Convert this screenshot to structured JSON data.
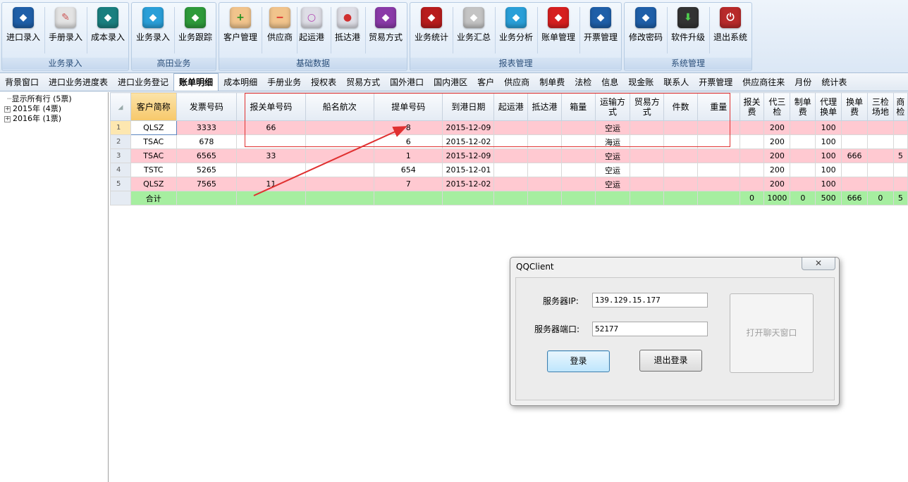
{
  "ribbon": {
    "groups": [
      {
        "label": "业务录入",
        "buttons": [
          {
            "label": "进口录入",
            "icon": "import-entry-icon",
            "color": "#1f5fa8",
            "glyph": "◆"
          },
          {
            "label": "手册录入",
            "icon": "manual-entry-icon",
            "color": "#d8d8d8",
            "glyph": "✎"
          },
          {
            "label": "成本录入",
            "icon": "cost-entry-icon",
            "color": "#1a8a8a",
            "glyph": "◆"
          }
        ]
      },
      {
        "label": "高田业务",
        "buttons": [
          {
            "label": "业务录入",
            "icon": "business-entry-icon",
            "color": "#2a9fd8",
            "glyph": "◆"
          },
          {
            "label": "业务跟踪",
            "icon": "business-track-icon",
            "color": "#2e9a3a",
            "glyph": "◆"
          }
        ]
      },
      {
        "label": "基础数据",
        "buttons": [
          {
            "label": "客户管理",
            "icon": "customer-add-icon",
            "color": "#e8b070",
            "glyph": "+"
          },
          {
            "label": "供应商",
            "icon": "supplier-icon",
            "color": "#e8b070",
            "glyph": "−"
          },
          {
            "label": "起运港",
            "icon": "origin-port-icon",
            "color": "#d0d0d8",
            "glyph": "○"
          },
          {
            "label": "抵达港",
            "icon": "arrival-port-icon",
            "color": "#d0d0d8",
            "glyph": "●"
          },
          {
            "label": "贸易方式",
            "icon": "trade-mode-icon",
            "color": "#8a3aa8",
            "glyph": "◆"
          }
        ]
      },
      {
        "label": "报表管理",
        "buttons": [
          {
            "label": "业务统计",
            "icon": "business-stats-icon",
            "color": "#b81c1c",
            "glyph": "◆"
          },
          {
            "label": "业务汇总",
            "icon": "business-summary-icon",
            "color": "#bdbdbd",
            "glyph": "◆"
          },
          {
            "label": "业务分析",
            "icon": "business-analysis-icon",
            "color": "#2a9fd8",
            "glyph": "◆"
          },
          {
            "label": "账单管理",
            "icon": "bill-manage-icon",
            "color": "#d61f1f",
            "glyph": "◆"
          },
          {
            "label": "开票管理",
            "icon": "invoice-manage-icon",
            "color": "#1f5fa8",
            "glyph": "◆"
          }
        ]
      },
      {
        "label": "系统管理",
        "buttons": [
          {
            "label": "修改密码",
            "icon": "change-password-icon",
            "color": "#1f5fa8",
            "glyph": "◆"
          },
          {
            "label": "软件升级",
            "icon": "software-upgrade-icon",
            "color": "#333333",
            "glyph": "⬇"
          },
          {
            "label": "退出系统",
            "icon": "exit-system-icon",
            "color": "#b82a2a",
            "glyph": "⏻"
          }
        ]
      }
    ]
  },
  "tabs": [
    "背景窗口",
    "进口业务进度表",
    "进口业务登记",
    "账单明细",
    "成本明细",
    "手册业务",
    "授权表",
    "贸易方式",
    "国外港口",
    "国内港区",
    "客户",
    "供应商",
    "制单费",
    "法检",
    "信息",
    "现金账",
    "联系人",
    "开票管理",
    "供应商往来",
    "月份",
    "统计表"
  ],
  "active_tab": "账单明细",
  "tree": {
    "root": "显示所有行 (5票)",
    "nodes": [
      "2015年 (4票)",
      "2016年 (1票)"
    ]
  },
  "grid": {
    "columns": [
      "客户简称",
      "发票号码",
      "报关单号码",
      "船名航次",
      "提单号码",
      "到港日期",
      "起运港",
      "抵达港",
      "箱量",
      "运输方式",
      "贸易方式",
      "件数",
      "重量",
      "报关费",
      "代三检",
      "制单费",
      "代理换单",
      "换单费",
      "三检场地",
      "商检"
    ],
    "rows": [
      {
        "n": "1",
        "style": "pink",
        "cells": [
          "QLSZ",
          "3333",
          "66",
          "",
          "8",
          "2015-12-09",
          "",
          "",
          "",
          "空运",
          "",
          "",
          "",
          "",
          "200",
          "",
          "100",
          "",
          "",
          ""
        ]
      },
      {
        "n": "2",
        "style": "white",
        "cells": [
          "TSAC",
          "678",
          "",
          "",
          "6",
          "2015-12-02",
          "",
          "",
          "",
          "海运",
          "",
          "",
          "",
          "",
          "200",
          "",
          "100",
          "",
          "",
          ""
        ]
      },
      {
        "n": "3",
        "style": "pink",
        "cells": [
          "TSAC",
          "6565",
          "33",
          "",
          "1",
          "2015-12-09",
          "",
          "",
          "",
          "空运",
          "",
          "",
          "",
          "",
          "200",
          "",
          "100",
          "666",
          "",
          "5"
        ]
      },
      {
        "n": "4",
        "style": "white",
        "cells": [
          "TSTC",
          "5265",
          "",
          "",
          "654",
          "2015-12-01",
          "",
          "",
          "",
          "空运",
          "",
          "",
          "",
          "",
          "200",
          "",
          "100",
          "",
          "",
          ""
        ]
      },
      {
        "n": "5",
        "style": "pink",
        "cells": [
          "QLSZ",
          "7565",
          "11",
          "",
          "7",
          "2015-12-02",
          "",
          "",
          "",
          "空运",
          "",
          "",
          "",
          "",
          "200",
          "",
          "100",
          "",
          "",
          ""
        ]
      }
    ],
    "total": {
      "cells": [
        "合计",
        "",
        "",
        "",
        "",
        "",
        "",
        "",
        "",
        "",
        "",
        "",
        "",
        "0",
        "1000",
        "0",
        "500",
        "666",
        "0",
        "5"
      ]
    }
  },
  "dialog": {
    "title": "QQClient",
    "close": "✕",
    "server_ip_label": "服务器IP:",
    "server_ip_value": "139.129.15.177",
    "server_port_label": "服务器端口:",
    "server_port_value": "52177",
    "login": "登录",
    "logout": "退出登录",
    "open_chat": "打开聊天窗口"
  },
  "colors": {
    "row_pink": "#ffc9d1",
    "total_green": "#a6eea0",
    "annotation_red": "#e03030"
  }
}
